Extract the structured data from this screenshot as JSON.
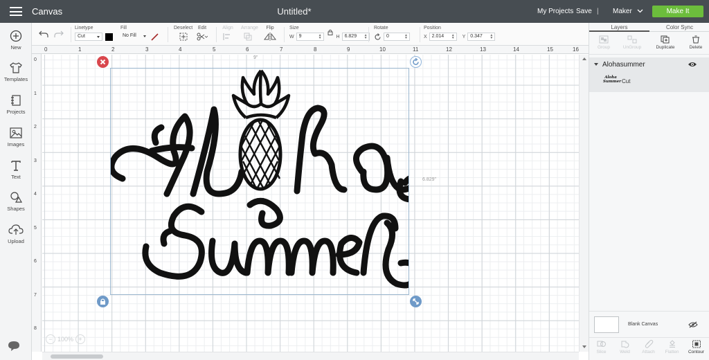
{
  "header": {
    "brand": "Canvas",
    "document_title": "Untitled*",
    "my_projects": "My Projects",
    "save": "Save",
    "separator": "|",
    "machine": "Maker",
    "make_it": "Make It",
    "accent_color": "#6cbd3c"
  },
  "left_toolbar": {
    "items": [
      {
        "label": "New",
        "icon": "plus-circle-icon"
      },
      {
        "label": "Templates",
        "icon": "shirt-icon"
      },
      {
        "label": "Projects",
        "icon": "notebook-icon"
      },
      {
        "label": "Images",
        "icon": "image-icon"
      },
      {
        "label": "Text",
        "icon": "text-icon"
      },
      {
        "label": "Shapes",
        "icon": "shapes-icon"
      },
      {
        "label": "Upload",
        "icon": "cloud-upload-icon"
      }
    ],
    "chat_icon": "chat-bubble-icon"
  },
  "edit_toolbar": {
    "linetype_label": "Linetype",
    "linetype_value": "Cut",
    "fill_label": "Fill",
    "fill_value": "No Fill",
    "swatch_color": "#000000",
    "deselect_label": "Deselect",
    "edit_label": "Edit",
    "align_label": "Align",
    "arrange_label": "Arrange",
    "flip_label": "Flip",
    "size_label": "Size",
    "width_letter": "W",
    "width_value": "9",
    "height_letter": "H",
    "height_value": "6.829",
    "rotate_label": "Rotate",
    "rotate_value": "0",
    "position_label": "Position",
    "x_letter": "X",
    "x_value": "2.014",
    "y_letter": "Y",
    "y_value": "0.347"
  },
  "ruler": {
    "top": [
      "0",
      "1",
      "2",
      "3",
      "4",
      "5",
      "6",
      "7",
      "8",
      "9",
      "10",
      "11",
      "12",
      "13",
      "14",
      "15",
      "16"
    ],
    "left": [
      "0",
      "1",
      "2",
      "3",
      "4",
      "5",
      "6",
      "7",
      "8"
    ]
  },
  "canvas": {
    "width_label": "9\"",
    "height_label": "6.829\"",
    "zoom_value": "100%",
    "design_line1": "Aloha",
    "design_line2": "Summer"
  },
  "right_panel": {
    "tab_layers": "Layers",
    "tab_color_sync": "Color Sync",
    "actions": [
      "Group",
      "UnGroup",
      "Duplicate",
      "Delete"
    ],
    "layer_group_name": "Alohasummer",
    "layer_item_name": "Cut",
    "blank_canvas_label": "Blank Canvas",
    "bottom_actions": [
      "Slice",
      "Weld",
      "Attach",
      "Flatten",
      "Contour"
    ]
  }
}
